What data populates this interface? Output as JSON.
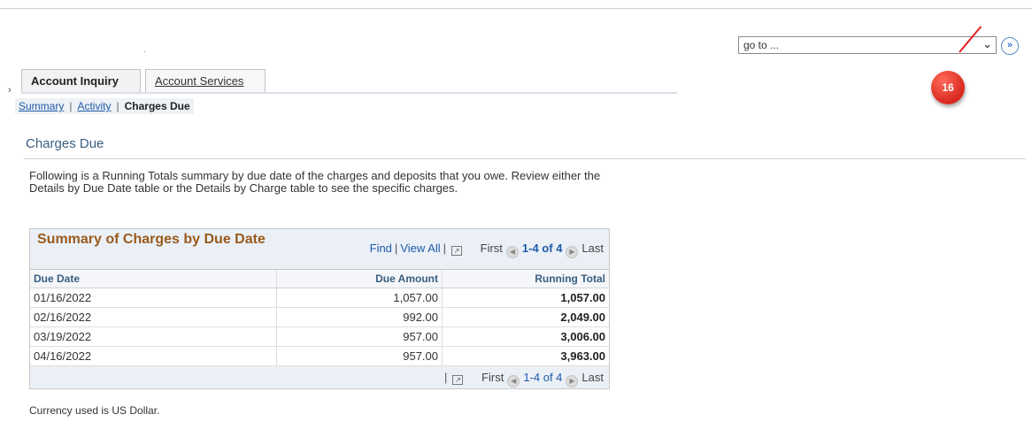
{
  "header": {
    "dot": ".",
    "goto_value": "go to ...",
    "go_button": "»",
    "callout_number": "16",
    "stray_mark": "›"
  },
  "tabs": [
    {
      "label": "Account Inquiry",
      "active": true
    },
    {
      "label": "Account Services",
      "active": false
    }
  ],
  "subnav": {
    "items": [
      "Summary",
      "Activity",
      "Charges Due"
    ],
    "separator": "|"
  },
  "page": {
    "title": "Charges Due",
    "intro": "Following is a Running Totals summary by due date of the charges and deposits that you owe. Review either the Details by Due Date table or the Details by Charge table to see the specific charges."
  },
  "grid": {
    "title": "Summary of Charges by Due Date",
    "find": "Find",
    "view_all": "View All",
    "first": "First",
    "range": "1-4 of 4",
    "last": "Last",
    "columns": [
      "Due Date",
      "Due Amount",
      "Running Total"
    ],
    "rows": [
      [
        "01/16/2022",
        "1,057.00",
        "1,057.00"
      ],
      [
        "02/16/2022",
        "992.00",
        "2,049.00"
      ],
      [
        "03/19/2022",
        "957.00",
        "3,006.00"
      ],
      [
        "04/16/2022",
        "957.00",
        "3,963.00"
      ]
    ]
  },
  "footer": {
    "currency": "Currency used is US Dollar."
  },
  "colors": {
    "grid_title": "#9a5a1c",
    "link": "#1e5aa8",
    "callout": "#d8281e",
    "header_bg": "#eaf0f6"
  },
  "icons": [
    "chevron-down-icon",
    "double-chevron-right-icon",
    "previous-icon",
    "next-icon",
    "zoom-icon"
  ]
}
